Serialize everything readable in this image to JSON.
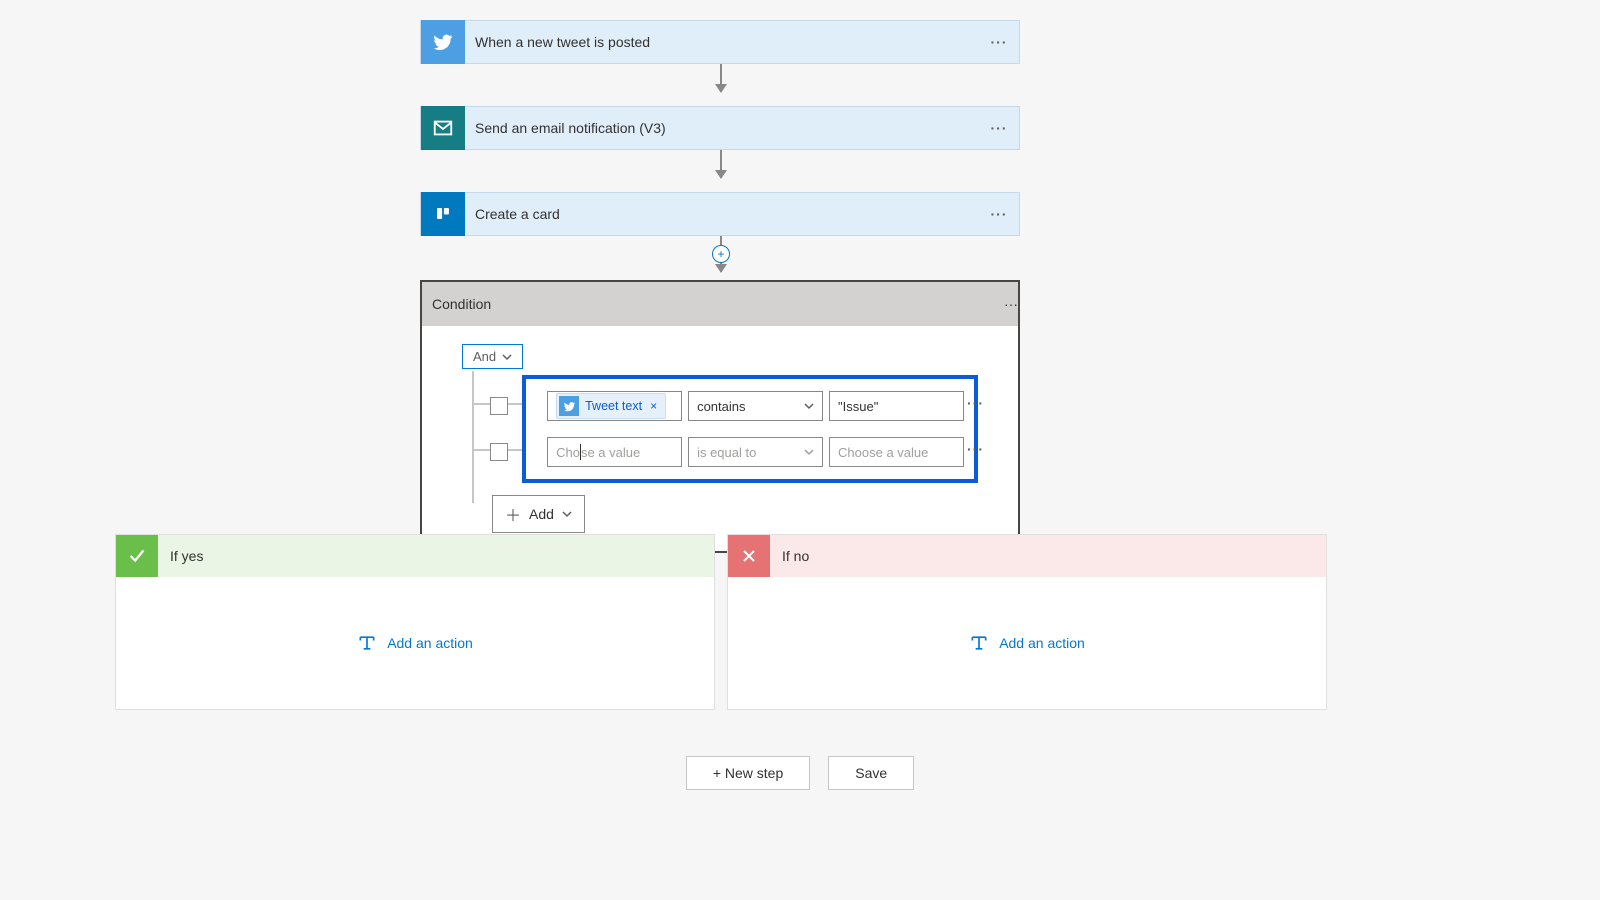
{
  "steps": [
    {
      "title": "When a new tweet is posted"
    },
    {
      "title": "Send an email notification (V3)"
    },
    {
      "title": "Create a card"
    }
  ],
  "condition": {
    "title": "Condition",
    "group_op": "And",
    "rows": [
      {
        "token_label": "Tweet text",
        "operator": "contains",
        "value": "\"Issue\"",
        "value_placeholder": "Choose a value",
        "field_placeholder": "Choose a value",
        "operator_placeholder": "is equal to"
      },
      {
        "token_label": "",
        "operator": "",
        "value": "",
        "value_placeholder": "Choose a value",
        "field_placeholder": "Choose a value",
        "operator_placeholder": "is equal to"
      }
    ],
    "add_label": "Add"
  },
  "branches": {
    "yes": {
      "label": "If yes",
      "action_label": "Add an action"
    },
    "no": {
      "label": "If no",
      "action_label": "Add an action"
    }
  },
  "footer": {
    "new_step": "+ New step",
    "save": "Save"
  },
  "glyphs": {
    "ellipsis": "···"
  }
}
